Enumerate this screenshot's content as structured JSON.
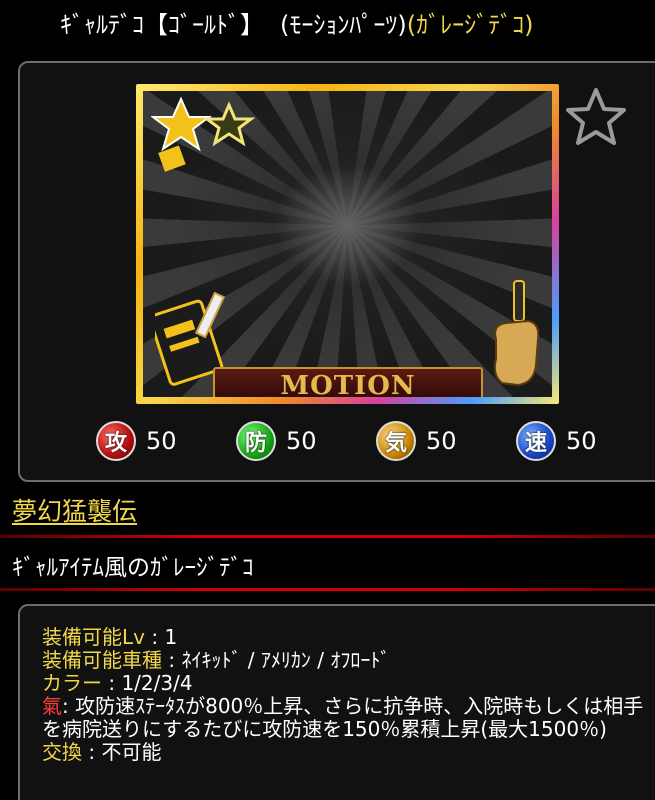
{
  "header": {
    "item_name": "ｷﾞｬﾙﾃﾞｺ【ｺﾞｰﾙﾄﾞ】",
    "type_label": "(ﾓｰｼｮﾝﾊﾟｰﾂ)",
    "category_label": "(ｶﾞﾚｰｼﾞﾃﾞｺ)"
  },
  "card": {
    "banner_text": "MOTION",
    "favorite_icon": "star-outline-icon"
  },
  "stats": [
    {
      "icon_char": "攻",
      "value": "50",
      "color": "#b00d0d"
    },
    {
      "icon_char": "防",
      "value": "50",
      "color": "#16a316"
    },
    {
      "icon_char": "気",
      "value": "50",
      "color": "#c98500"
    },
    {
      "icon_char": "速",
      "value": "50",
      "color": "#1545c9"
    }
  ],
  "series_link": "夢幻猛襲伝",
  "description": "ｷﾞｬﾙｱｲﾃﾑ風のｶﾞﾚｰｼﾞﾃﾞｺ",
  "details": {
    "lv_label": "装備可能Lv",
    "lv_value": "1",
    "vehicle_label": "装備可能車種",
    "vehicle_value": "ﾈｲｷｯﾄﾞ / ｱﾒﾘｶﾝ / ｵﾌﾛｰﾄﾞ",
    "color_label": "カラー",
    "color_value": "1/2/3/4",
    "ki_label": "氣",
    "ki_text": "攻防速ｽﾃｰﾀｽが800％上昇、さらに抗争時、入院時もしくは相手を病院送りにするたびに攻防速を150％累積上昇(最大1500％)",
    "trade_label": "交換",
    "trade_value": "不可能"
  },
  "colors": {
    "accent_yellow": "#f0d74a",
    "accent_red": "#ff3b3b",
    "divider_red": "#d00000"
  }
}
